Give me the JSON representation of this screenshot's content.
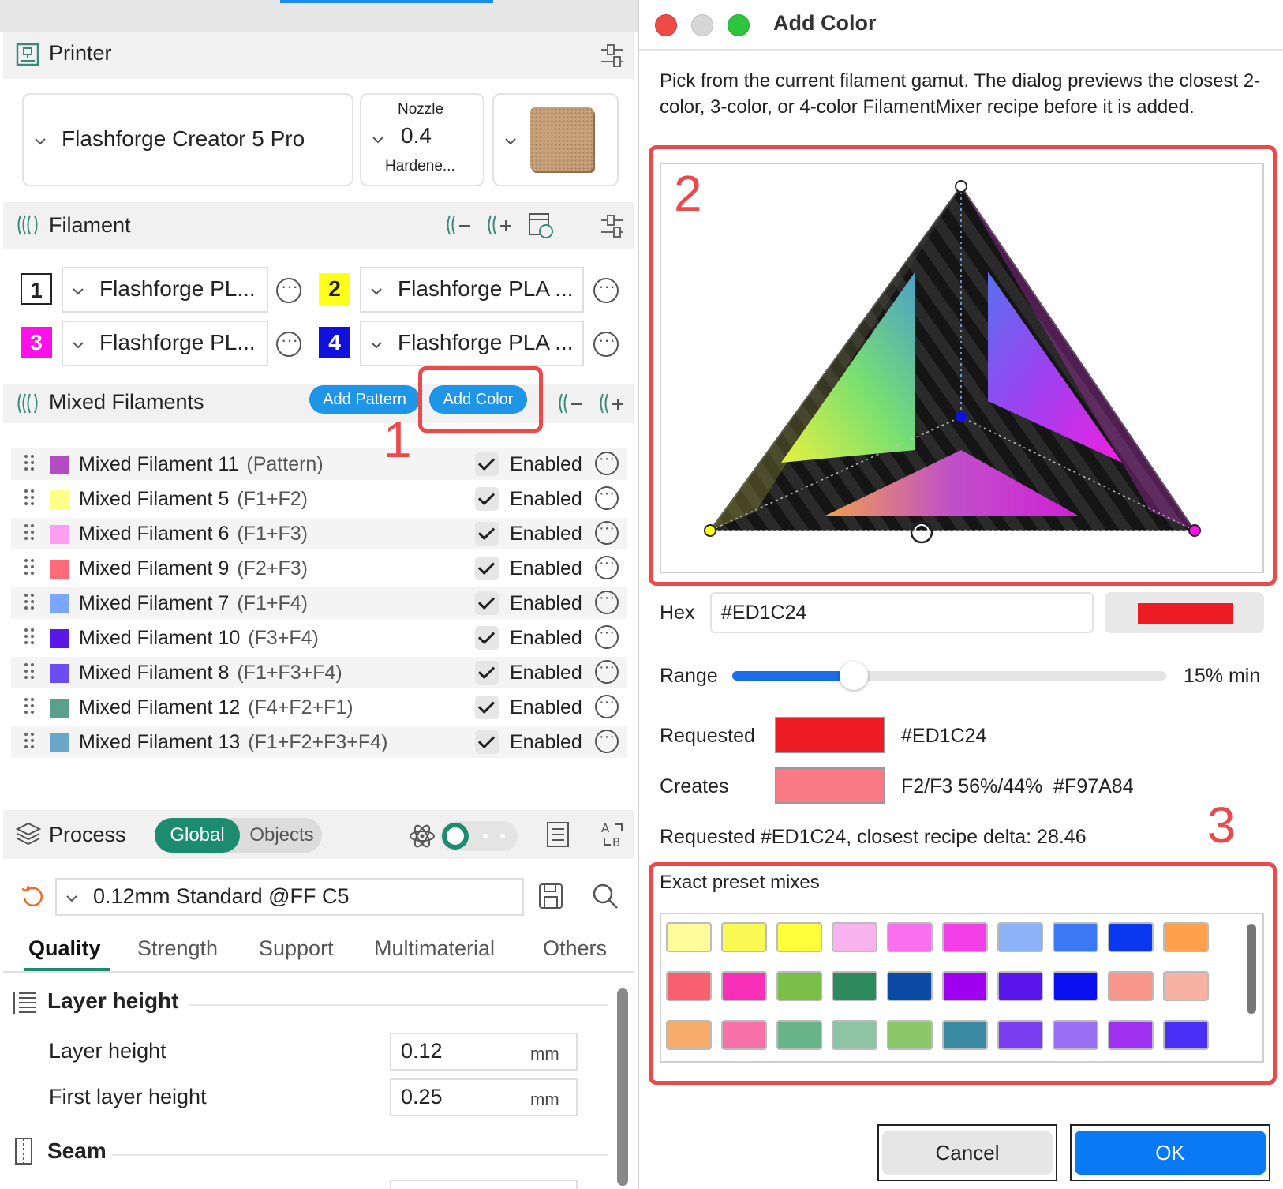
{
  "printer": {
    "section_title": "Printer",
    "printer_name": "Flashforge Creator 5 Pro",
    "nozzle_label": "Nozzle",
    "nozzle_value": "0.4",
    "nozzle_type": "Hardene..."
  },
  "filament": {
    "section_title": "Filament",
    "items": [
      {
        "num": "1",
        "name": "Flashforge PL...",
        "color": "#ffffff"
      },
      {
        "num": "2",
        "name": "Flashforge PLA ...",
        "color": "#ffff1a"
      },
      {
        "num": "3",
        "name": "Flashforge PL...",
        "color": "#ff10e8"
      },
      {
        "num": "4",
        "name": "Flashforge PLA ...",
        "color": "#1111dd"
      }
    ]
  },
  "mixed": {
    "section_title": "Mixed Filaments",
    "add_pattern": "Add Pattern",
    "add_color": "Add Color",
    "enabled_label": "Enabled",
    "rows": [
      {
        "name": "Mixed Filament 11",
        "recipe": "(Pattern)",
        "color": "#b24cc0"
      },
      {
        "name": "Mixed Filament 5",
        "recipe": "(F1+F2)",
        "color": "#ffff8a"
      },
      {
        "name": "Mixed Filament 6",
        "recipe": "(F1+F3)",
        "color": "#ff9ef0"
      },
      {
        "name": "Mixed Filament 9",
        "recipe": "(F2+F3)",
        "color": "#ff6a7a"
      },
      {
        "name": "Mixed Filament 7",
        "recipe": "(F1+F4)",
        "color": "#7aa6ff"
      },
      {
        "name": "Mixed Filament 10",
        "recipe": "(F3+F4)",
        "color": "#5a18e8"
      },
      {
        "name": "Mixed Filament 8",
        "recipe": "(F1+F3+F4)",
        "color": "#6a4cf0"
      },
      {
        "name": "Mixed Filament 12",
        "recipe": "(F4+F2+F1)",
        "color": "#5aa08a"
      },
      {
        "name": "Mixed Filament 13",
        "recipe": "(F1+F2+F3+F4)",
        "color": "#6aa6c8"
      }
    ]
  },
  "process": {
    "section_title": "Process",
    "toggle_global": "Global",
    "toggle_objects": "Objects",
    "profile": "0.12mm Standard @FF C5",
    "tabs": [
      "Quality",
      "Strength",
      "Support",
      "Multimaterial",
      "Others"
    ],
    "layer_group": "Layer height",
    "layer_height_label": "Layer height",
    "layer_height_value": "0.12",
    "first_layer_label": "First layer height",
    "first_layer_value": "0.25",
    "unit": "mm",
    "seam_group": "Seam"
  },
  "annotations": {
    "n1": "1",
    "n2": "2",
    "n3": "3"
  },
  "dialog": {
    "title": "Add Color",
    "description": "Pick from the current filament gamut. The dialog previews the closest 2-color, 3-color, or 4-color FilamentMixer recipe before it is added.",
    "hex_label": "Hex",
    "hex_value": "#ED1C24",
    "hex_swatch": "#ED1C24",
    "range_label": "Range",
    "range_value": "15% min",
    "range_fraction": 0.28,
    "requested_label": "Requested",
    "requested_hex": "#ED1C24",
    "requested_color": "#ED1C24",
    "creates_label": "Creates",
    "creates_text": "F2/F3 56%/44%  #F97A84",
    "creates_color": "#F97A84",
    "delta_text": "Requested #ED1C24, closest recipe delta: 28.46",
    "presets_label": "Exact preset mixes",
    "presets": [
      "#fdfd9c",
      "#fafa55",
      "#ffff3c",
      "#f8b2ee",
      "#f870ee",
      "#f43ee8",
      "#8cb2f8",
      "#3a78f4",
      "#0a38f0",
      "#ffa04c",
      "#f86070",
      "#f830b8",
      "#7ac048",
      "#2e8a5c",
      "#0a4aa4",
      "#a000f0",
      "#5a14ec",
      "#0a10f0",
      "#f8968a",
      "#f8b2a4",
      "#f8ac6c",
      "#f870a8",
      "#6ab48a",
      "#8cc4a4",
      "#8cc86a",
      "#3a8aa4",
      "#7a3ef0",
      "#9a70f4",
      "#a030f0",
      "#4a30f4"
    ],
    "cancel": "Cancel",
    "ok": "OK"
  }
}
